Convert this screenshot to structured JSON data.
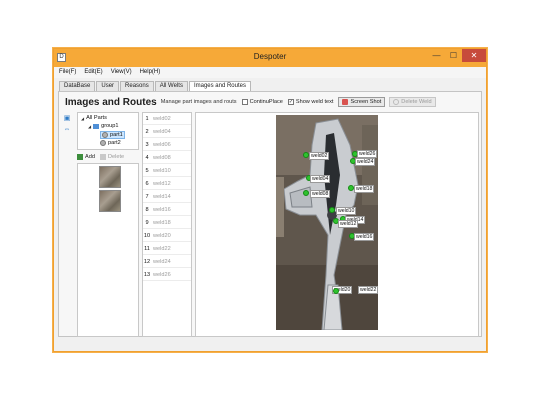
{
  "window": {
    "title": "Despoter",
    "app_icon": "D"
  },
  "window_controls": {
    "minimize": "—",
    "maximize": "☐",
    "close": "✕"
  },
  "menu": [
    "File(F)",
    "Edit(E)",
    "View(V)",
    "Help(H)"
  ],
  "tabs": [
    "DataBase",
    "User",
    "Reasons",
    "All Welts",
    "Images and Routes"
  ],
  "active_tab": "Images and Routes",
  "header": {
    "title": "Images and Routes",
    "subtitle": "Manage part images and routs",
    "continu_place": "ContinuPlace",
    "continu_place_checked": false,
    "show_weld_text": "Show weld text",
    "show_weld_text_checked": true,
    "screenshot": "Screen Shot",
    "delete_weld": "Delete Weld"
  },
  "tree": {
    "root": "All Parts",
    "group": "group1",
    "parts": [
      "part1",
      "part2"
    ],
    "selected": "part1"
  },
  "tree_buttons": {
    "add": "Add",
    "delete": "Delete"
  },
  "weld_list": [
    {
      "n": "1",
      "name": "weld02"
    },
    {
      "n": "2",
      "name": "weld04"
    },
    {
      "n": "3",
      "name": "weld06"
    },
    {
      "n": "4",
      "name": "weld08"
    },
    {
      "n": "5",
      "name": "weld10"
    },
    {
      "n": "6",
      "name": "weld12"
    },
    {
      "n": "7",
      "name": "weld14"
    },
    {
      "n": "8",
      "name": "weld16"
    },
    {
      "n": "9",
      "name": "weld18"
    },
    {
      "n": "10",
      "name": "weld20"
    },
    {
      "n": "11",
      "name": "weld22"
    },
    {
      "n": "12",
      "name": "weld24"
    },
    {
      "n": "13",
      "name": "weld26"
    }
  ],
  "weld_labels": [
    "weld02",
    "weld26",
    "weld24",
    "weld04",
    "weld18",
    "weld08",
    "weld10",
    "weld14",
    "weld12",
    "weld16",
    "weld20",
    "weld22"
  ],
  "colors": {
    "titlebar": "#f6a938",
    "weld_dot": "#2fc22f",
    "close": "#c74b3b"
  }
}
